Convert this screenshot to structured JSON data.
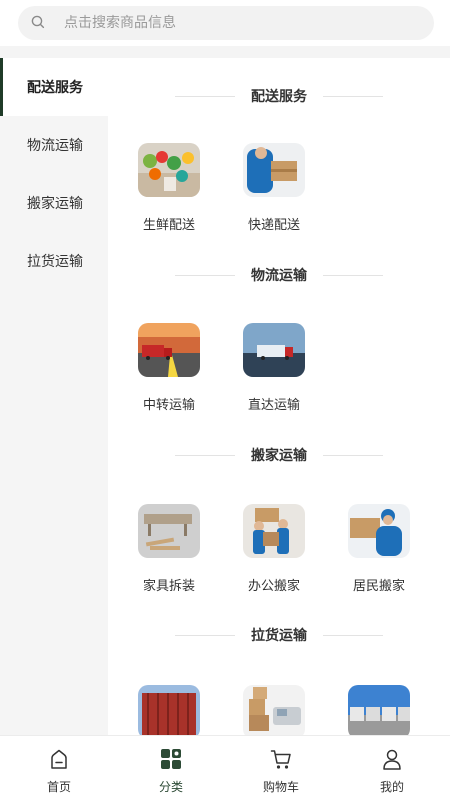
{
  "search": {
    "placeholder": "点击搜索商品信息"
  },
  "sidebar": {
    "items": [
      {
        "label": "配送服务",
        "active": true
      },
      {
        "label": "物流运输",
        "active": false
      },
      {
        "label": "搬家运输",
        "active": false
      },
      {
        "label": "拉货运输",
        "active": false
      }
    ]
  },
  "sections": [
    {
      "title": "配送服务",
      "items": [
        {
          "name": "生鲜配送"
        },
        {
          "name": "快递配送"
        }
      ]
    },
    {
      "title": "物流运输",
      "items": [
        {
          "name": "中转运输"
        },
        {
          "name": "直达运输"
        }
      ]
    },
    {
      "title": "搬家运输",
      "items": [
        {
          "name": "家具拆装"
        },
        {
          "name": "办公搬家"
        },
        {
          "name": "居民搬家"
        }
      ]
    },
    {
      "title": "拉货运输",
      "items": [
        {
          "name": ""
        },
        {
          "name": ""
        },
        {
          "name": ""
        }
      ]
    }
  ],
  "tabbar": {
    "items": [
      {
        "label": "首页",
        "icon": "home-icon"
      },
      {
        "label": "分类",
        "icon": "category-icon",
        "active": true
      },
      {
        "label": "购物车",
        "icon": "cart-icon"
      },
      {
        "label": "我的",
        "icon": "user-icon"
      }
    ]
  },
  "colors": {
    "accent": "#2c4a35",
    "sidebar_bg": "#f5f5f5"
  }
}
